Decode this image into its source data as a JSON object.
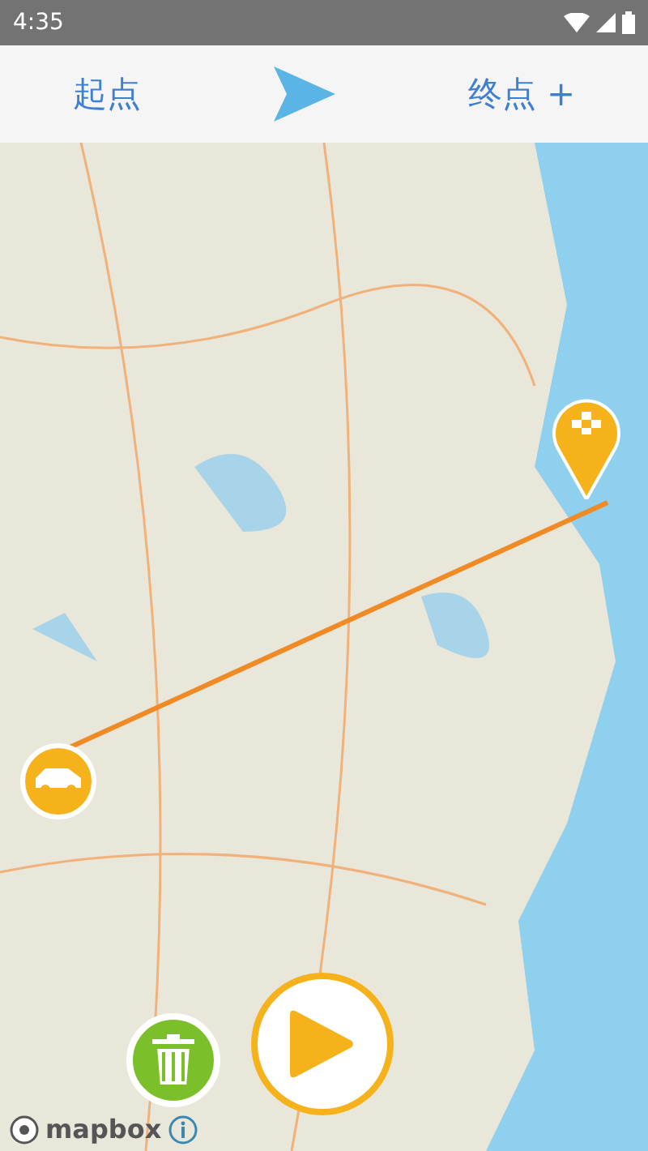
{
  "status_bar": {
    "time": "4:35"
  },
  "route_bar": {
    "start": "起点",
    "end": "终点 +"
  },
  "map": {
    "attribution": "mapbox"
  }
}
